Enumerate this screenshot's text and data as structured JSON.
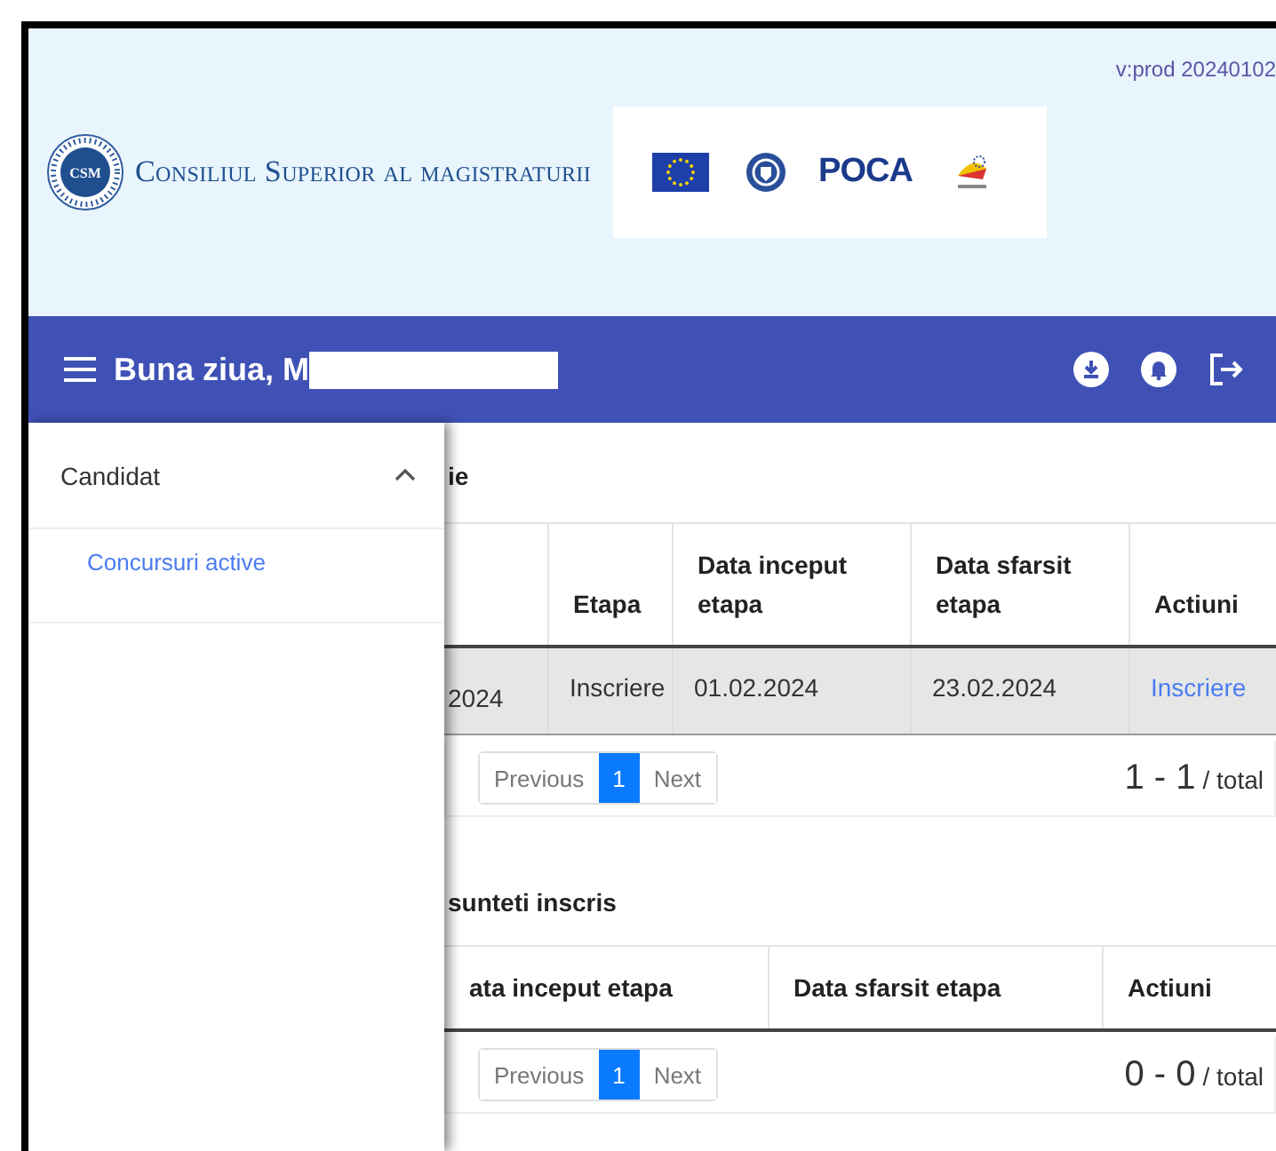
{
  "version": "v:prod 20240102",
  "brand": {
    "seal": "CSM",
    "name": "Consiliul Superior al magistraturii"
  },
  "partners": {
    "poca": "POCA"
  },
  "navbar": {
    "greeting": "Buna ziua, M",
    "name_redacted": true
  },
  "sidebar": {
    "groups": [
      {
        "label": "Candidat",
        "expanded": true,
        "items": [
          {
            "label": "Concursuri active",
            "selected": false
          }
        ]
      }
    ]
  },
  "sections": [
    {
      "title": "ie",
      "table": {
        "columns": [
          {
            "kind": "cut"
          },
          {
            "kind": "heading",
            "label": "Etapa"
          },
          {
            "kind": "heading",
            "label": "Data inceput etapa"
          },
          {
            "kind": "heading",
            "label": "Data sfarsit etapa"
          },
          {
            "kind": "heading",
            "label": "Actiuni"
          }
        ],
        "rows": [
          {
            "selected": true,
            "cells": [
              {
                "kind": "text",
                "text": "2024"
              },
              {
                "kind": "text",
                "text": "Inscriere"
              },
              {
                "kind": "text",
                "text": "01.02.2024"
              },
              {
                "kind": "text",
                "text": "23.02.2024"
              },
              {
                "kind": "link",
                "text": "Inscriere"
              }
            ]
          }
        ]
      },
      "pager": {
        "previous": "Previous",
        "pages": [
          {
            "label": "1",
            "selected": true
          }
        ],
        "next": "Next",
        "range": "1 - 1",
        "total": "/ total"
      }
    },
    {
      "title": "sunteti inscris",
      "table": {
        "columns": [
          {
            "kind": "heading",
            "label": "ata inceput etapa"
          },
          {
            "kind": "heading",
            "label": "Data sfarsit etapa"
          },
          {
            "kind": "heading",
            "label": "Actiuni"
          }
        ]
      },
      "pager": {
        "previous": "Previous",
        "pages": [
          {
            "label": "1",
            "selected": true
          }
        ],
        "next": "Next",
        "range": "0 - 0",
        "total": "/ total"
      }
    }
  ]
}
